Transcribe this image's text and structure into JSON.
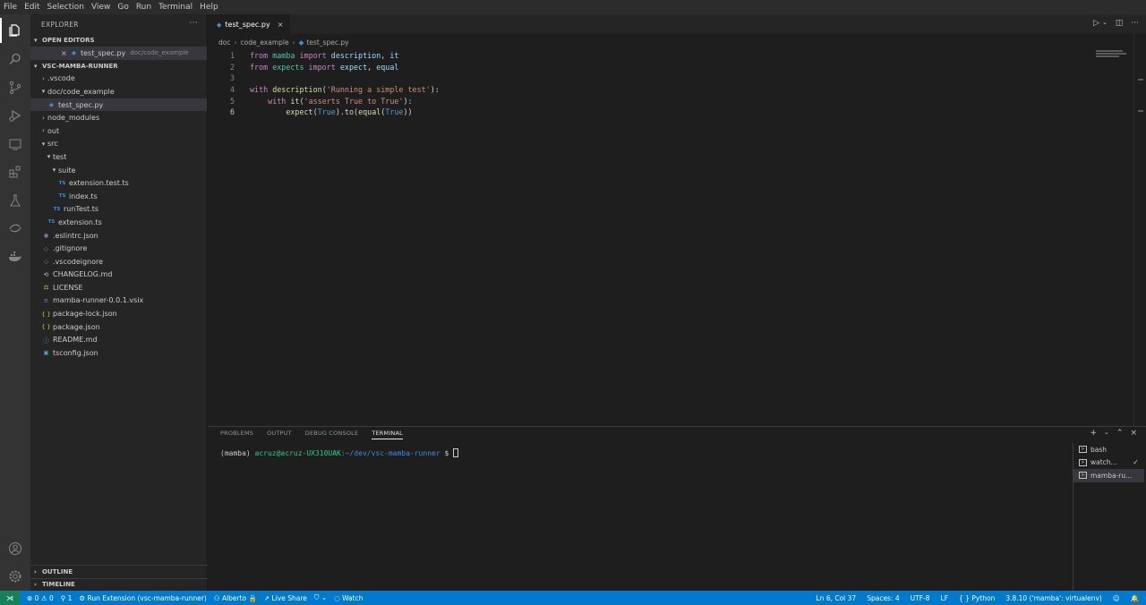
{
  "menu": [
    "File",
    "Edit",
    "Selection",
    "View",
    "Go",
    "Run",
    "Terminal",
    "Help"
  ],
  "activity_icons": [
    "explorer-icon",
    "search-icon",
    "source-control-icon",
    "run-debug-icon",
    "remote-explorer-icon",
    "extensions-icon",
    "testing-icon",
    "live-share-icon",
    "docker-icon"
  ],
  "activity_bottom_icons": [
    "account-icon",
    "manage-gear-icon"
  ],
  "sidebar": {
    "title": "EXPLORER",
    "open_editors": {
      "label": "OPEN EDITORS",
      "items": [
        {
          "name": "test_spec.py",
          "description": "doc/code_example"
        }
      ]
    },
    "project": {
      "label": "VSC-MAMBA-RUNNER",
      "tree": [
        {
          "label": ".vscode",
          "type": "folder",
          "depth": 0,
          "open": false
        },
        {
          "label": "doc/code_example",
          "type": "folder",
          "depth": 0,
          "open": true
        },
        {
          "label": "test_spec.py",
          "type": "py",
          "depth": 1,
          "selected": true
        },
        {
          "label": "node_modules",
          "type": "folder",
          "depth": 0,
          "open": false
        },
        {
          "label": "out",
          "type": "folder",
          "depth": 0,
          "open": false
        },
        {
          "label": "src",
          "type": "folder",
          "depth": 0,
          "open": true
        },
        {
          "label": "test",
          "type": "folder",
          "depth": 1,
          "open": true
        },
        {
          "label": "suite",
          "type": "folder",
          "depth": 2,
          "open": true
        },
        {
          "label": "extension.test.ts",
          "type": "ts",
          "depth": 3
        },
        {
          "label": "index.ts",
          "type": "ts",
          "depth": 3
        },
        {
          "label": "runTest.ts",
          "type": "ts",
          "depth": 2
        },
        {
          "label": "extension.ts",
          "type": "ts",
          "depth": 1
        },
        {
          "label": ".eslintrc.json",
          "type": "eslint",
          "depth": 0
        },
        {
          "label": ".gitignore",
          "type": "git",
          "depth": 0
        },
        {
          "label": ".vscodeignore",
          "type": "git",
          "depth": 0
        },
        {
          "label": "CHANGELOG.md",
          "type": "changelog",
          "depth": 0
        },
        {
          "label": "LICENSE",
          "type": "lic",
          "depth": 0
        },
        {
          "label": "mamba-runner-0.0.1.vsix",
          "type": "vsix",
          "depth": 0
        },
        {
          "label": "package-lock.json",
          "type": "json",
          "depth": 0
        },
        {
          "label": "package.json",
          "type": "json",
          "depth": 0
        },
        {
          "label": "README.md",
          "type": "md",
          "depth": 0
        },
        {
          "label": "tsconfig.json",
          "type": "tsconfig",
          "depth": 0
        }
      ]
    },
    "outline_label": "OUTLINE",
    "timeline_label": "TIMELINE"
  },
  "editor": {
    "tab": {
      "name": "test_spec.py"
    },
    "breadcrumb": [
      "doc",
      "code_example",
      "test_spec.py"
    ],
    "current_line": 6,
    "lines": [
      [
        [
          "kw",
          "from "
        ],
        [
          "mod",
          "mamba"
        ],
        [
          "kw",
          " import "
        ],
        [
          "ident",
          "description"
        ],
        [
          "plain",
          ", "
        ],
        [
          "ident",
          "it"
        ]
      ],
      [
        [
          "kw",
          "from "
        ],
        [
          "mod",
          "expects"
        ],
        [
          "kw",
          " import "
        ],
        [
          "ident",
          "expect"
        ],
        [
          "plain",
          ", "
        ],
        [
          "ident",
          "equal"
        ]
      ],
      [],
      [
        [
          "kw",
          "with "
        ],
        [
          "fn",
          "description"
        ],
        [
          "plain",
          "("
        ],
        [
          "str",
          "'Running a simple test'"
        ],
        [
          "plain",
          "):"
        ]
      ],
      [
        [
          "plain",
          "    "
        ],
        [
          "kw",
          "with "
        ],
        [
          "fn",
          "it"
        ],
        [
          "plain",
          "("
        ],
        [
          "str",
          "'asserts True to True'"
        ],
        [
          "plain",
          "):"
        ]
      ],
      [
        [
          "plain",
          "        "
        ],
        [
          "fn",
          "expect"
        ],
        [
          "plain",
          "("
        ],
        [
          "bi",
          "True"
        ],
        [
          "plain",
          ")."
        ],
        [
          "fn",
          "to"
        ],
        [
          "plain",
          "("
        ],
        [
          "fn",
          "equal"
        ],
        [
          "plain",
          "("
        ],
        [
          "bi",
          "True"
        ],
        [
          "plain",
          "))"
        ]
      ]
    ]
  },
  "panel": {
    "tabs": [
      "PROBLEMS",
      "OUTPUT",
      "DEBUG CONSOLE",
      "TERMINAL"
    ],
    "active_tab": "TERMINAL",
    "terminal": {
      "env": "(mamba) ",
      "user": "acruz@acruz-UX310UAK",
      "path": ":~/dev/vsc-mamba-runner",
      "prompt": " $ "
    },
    "terminals": [
      {
        "label": "bash",
        "active": false,
        "check": false
      },
      {
        "label": "watch...",
        "active": false,
        "check": true
      },
      {
        "label": "mamba-ru...",
        "active": true,
        "check": false
      }
    ]
  },
  "statusbar": {
    "errors": "0",
    "warnings": "0",
    "ports": "1",
    "run": "Run Extension (vsc-mamba-runner)",
    "user": "Alberto",
    "live_share": "Live Share",
    "watch": "Watch",
    "position": "Ln 6, Col 37",
    "spaces": "Spaces: 4",
    "encoding": "UTF-8",
    "eol": "LF",
    "language": "Python",
    "interpreter": "3.8.10 ('mamba': virtualenv)"
  },
  "colors": {
    "status_bar": "#007acc",
    "remote": "#16825d",
    "activity_bar": "#333333",
    "sidebar": "#252526",
    "editor": "#1e1e1e"
  }
}
